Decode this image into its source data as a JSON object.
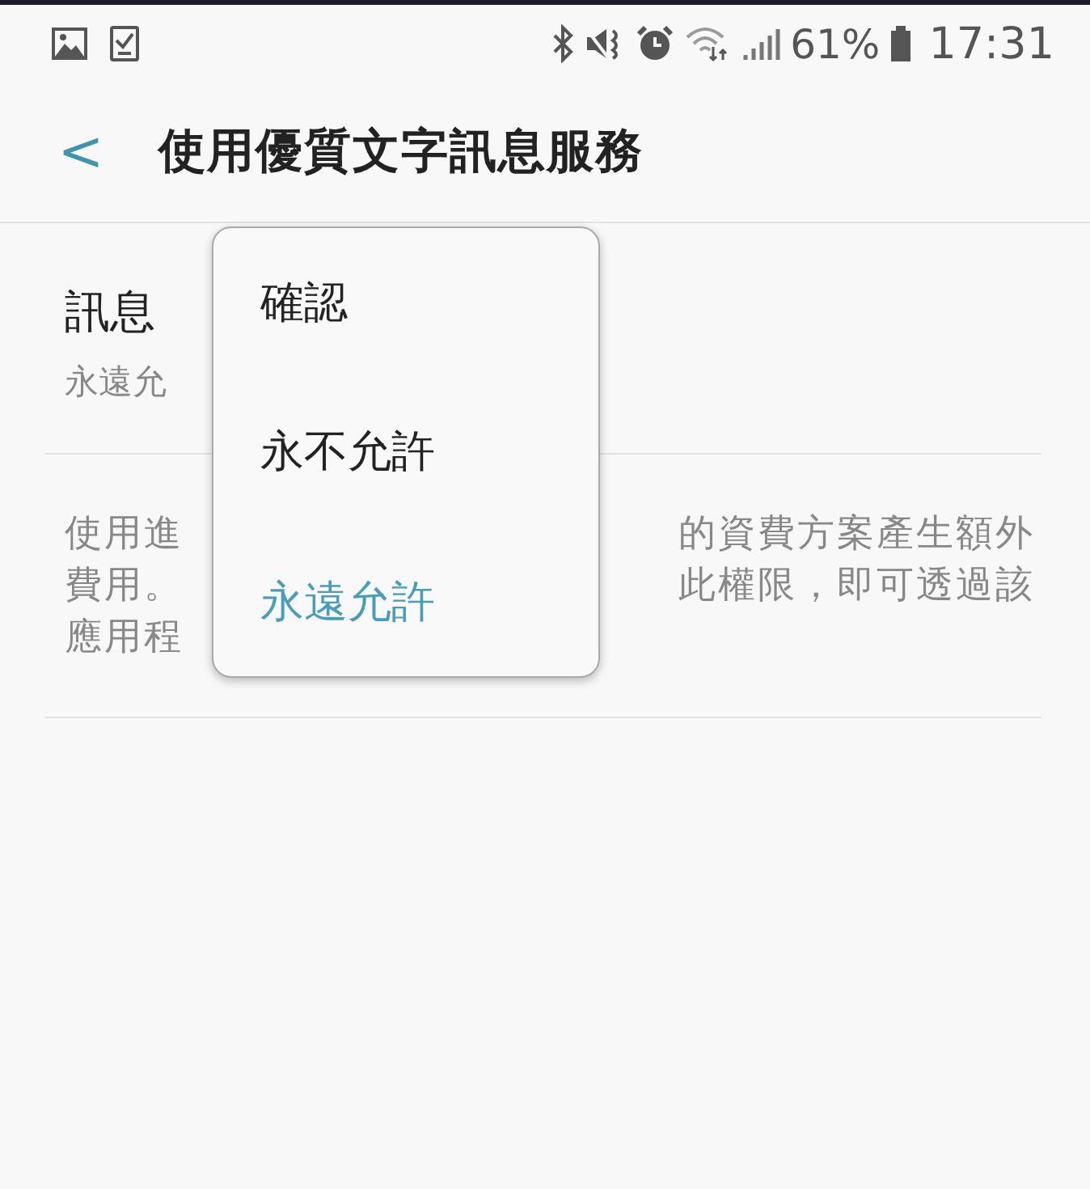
{
  "status_bar": {
    "battery_percent": "61%",
    "time": "17:31"
  },
  "header": {
    "back": "<",
    "title": "使用優質文字訊息服務"
  },
  "setting": {
    "title": "訊息",
    "value": "永遠允"
  },
  "description_lines": [
    {
      "left": "使用進",
      "right": "的資費方案產生額外"
    },
    {
      "left": "費用。",
      "right": "此權限，即可透過該"
    },
    {
      "left": "應用程"
    }
  ],
  "menu": {
    "options": [
      {
        "label": "確認",
        "selected": false
      },
      {
        "label": "永不允許",
        "selected": false
      },
      {
        "label": "永遠允許",
        "selected": true
      }
    ]
  }
}
